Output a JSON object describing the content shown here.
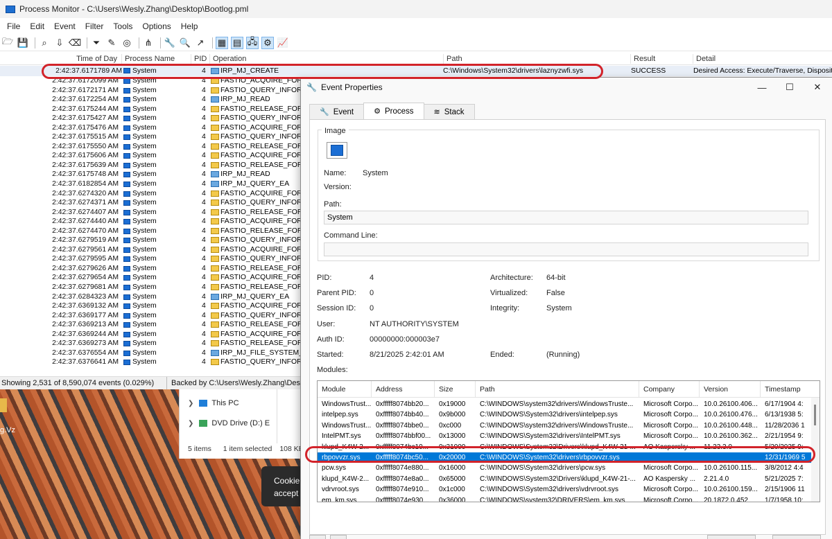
{
  "window": {
    "title": "Process Monitor - C:\\Users\\Wesly.Zhang\\Desktop\\Bootlog.pml"
  },
  "menu": [
    "File",
    "Edit",
    "Event",
    "Filter",
    "Tools",
    "Options",
    "Help"
  ],
  "toolbar_icons": [
    "open-icon",
    "save-icon",
    "capture-icon",
    "autoscroll-icon",
    "clear-icon",
    "filter-icon",
    "highlight-icon",
    "target-icon",
    "tree-icon",
    "find-icon",
    "jump-icon",
    "registry-icon",
    "filesystem-icon",
    "network-icon",
    "process-thread-icon",
    "profiling-icon"
  ],
  "columns": {
    "time": "Time of Day",
    "process": "Process Name",
    "pid": "PID",
    "operation": "Operation",
    "path": "Path",
    "result": "Result",
    "detail": "Detail"
  },
  "first_event": {
    "time": "2:42:37.6171789 AM",
    "process": "System",
    "pid": "4",
    "operation": "IRP_MJ_CREATE",
    "path": "C:\\Windows\\System32\\drivers\\laznyzwfi.sys",
    "result": "SUCCESS",
    "detail": "Desired Access: Execute/Traverse, Disposition"
  },
  "events": [
    {
      "time": "2:42:37.6172099 AM",
      "process": "System",
      "pid": "4",
      "operation": "FASTIO_ACQUIRE_FOR_",
      "kind": "fastio"
    },
    {
      "time": "2:42:37.6172171 AM",
      "process": "System",
      "pid": "4",
      "operation": "FASTIO_QUERY_INFORM",
      "kind": "fastio"
    },
    {
      "time": "2:42:37.6172254 AM",
      "process": "System",
      "pid": "4",
      "operation": "IRP_MJ_READ",
      "kind": "irp"
    },
    {
      "time": "2:42:37.6175244 AM",
      "process": "System",
      "pid": "4",
      "operation": "FASTIO_RELEASE_FOR_",
      "kind": "fastio"
    },
    {
      "time": "2:42:37.6175427 AM",
      "process": "System",
      "pid": "4",
      "operation": "FASTIO_QUERY_INFORM",
      "kind": "fastio"
    },
    {
      "time": "2:42:37.6175476 AM",
      "process": "System",
      "pid": "4",
      "operation": "FASTIO_ACQUIRE_FOR_",
      "kind": "fastio"
    },
    {
      "time": "2:42:37.6175515 AM",
      "process": "System",
      "pid": "4",
      "operation": "FASTIO_QUERY_INFORM",
      "kind": "fastio"
    },
    {
      "time": "2:42:37.6175550 AM",
      "process": "System",
      "pid": "4",
      "operation": "FASTIO_RELEASE_FOR_",
      "kind": "fastio"
    },
    {
      "time": "2:42:37.6175606 AM",
      "process": "System",
      "pid": "4",
      "operation": "FASTIO_ACQUIRE_FOR_",
      "kind": "fastio"
    },
    {
      "time": "2:42:37.6175639 AM",
      "process": "System",
      "pid": "4",
      "operation": "FASTIO_RELEASE_FOR_",
      "kind": "fastio"
    },
    {
      "time": "2:42:37.6175748 AM",
      "process": "System",
      "pid": "4",
      "operation": "IRP_MJ_READ",
      "kind": "irp"
    },
    {
      "time": "2:42:37.6182854 AM",
      "process": "System",
      "pid": "4",
      "operation": "IRP_MJ_QUERY_EA",
      "kind": "irp"
    },
    {
      "time": "2:42:37.6274320 AM",
      "process": "System",
      "pid": "4",
      "operation": "FASTIO_ACQUIRE_FOR_",
      "kind": "fastio"
    },
    {
      "time": "2:42:37.6274371 AM",
      "process": "System",
      "pid": "4",
      "operation": "FASTIO_QUERY_INFORM",
      "kind": "fastio"
    },
    {
      "time": "2:42:37.6274407 AM",
      "process": "System",
      "pid": "4",
      "operation": "FASTIO_RELEASE_FOR_",
      "kind": "fastio"
    },
    {
      "time": "2:42:37.6274440 AM",
      "process": "System",
      "pid": "4",
      "operation": "FASTIO_ACQUIRE_FOR_",
      "kind": "fastio"
    },
    {
      "time": "2:42:37.6274470 AM",
      "process": "System",
      "pid": "4",
      "operation": "FASTIO_RELEASE_FOR_",
      "kind": "fastio"
    },
    {
      "time": "2:42:37.6279519 AM",
      "process": "System",
      "pid": "4",
      "operation": "FASTIO_QUERY_INFORM",
      "kind": "fastio"
    },
    {
      "time": "2:42:37.6279561 AM",
      "process": "System",
      "pid": "4",
      "operation": "FASTIO_ACQUIRE_FOR_",
      "kind": "fastio"
    },
    {
      "time": "2:42:37.6279595 AM",
      "process": "System",
      "pid": "4",
      "operation": "FASTIO_QUERY_INFORM",
      "kind": "fastio"
    },
    {
      "time": "2:42:37.6279626 AM",
      "process": "System",
      "pid": "4",
      "operation": "FASTIO_RELEASE_FOR_",
      "kind": "fastio"
    },
    {
      "time": "2:42:37.6279654 AM",
      "process": "System",
      "pid": "4",
      "operation": "FASTIO_ACQUIRE_FOR_",
      "kind": "fastio"
    },
    {
      "time": "2:42:37.6279681 AM",
      "process": "System",
      "pid": "4",
      "operation": "FASTIO_RELEASE_FOR_",
      "kind": "fastio"
    },
    {
      "time": "2:42:37.6284323 AM",
      "process": "System",
      "pid": "4",
      "operation": "IRP_MJ_QUERY_EA",
      "kind": "irp"
    },
    {
      "time": "2:42:37.6369132 AM",
      "process": "System",
      "pid": "4",
      "operation": "FASTIO_ACQUIRE_FOR_",
      "kind": "fastio"
    },
    {
      "time": "2:42:37.6369177 AM",
      "process": "System",
      "pid": "4",
      "operation": "FASTIO_QUERY_INFORM",
      "kind": "fastio"
    },
    {
      "time": "2:42:37.6369213 AM",
      "process": "System",
      "pid": "4",
      "operation": "FASTIO_RELEASE_FOR_",
      "kind": "fastio"
    },
    {
      "time": "2:42:37.6369244 AM",
      "process": "System",
      "pid": "4",
      "operation": "FASTIO_ACQUIRE_FOR_",
      "kind": "fastio"
    },
    {
      "time": "2:42:37.6369273 AM",
      "process": "System",
      "pid": "4",
      "operation": "FASTIO_RELEASE_FOR_",
      "kind": "fastio"
    },
    {
      "time": "2:42:37.6376554 AM",
      "process": "System",
      "pid": "4",
      "operation": "IRP_MJ_FILE_SYSTEM_C",
      "kind": "irp"
    },
    {
      "time": "2:42:37.6376641 AM",
      "process": "System",
      "pid": "4",
      "operation": "FASTIO_QUERY_INFORM",
      "kind": "fastio"
    }
  ],
  "status": {
    "showing": "Showing 2,531 of 8,590,074 events (0.029%)",
    "backed": "Backed by C:\\Users\\Wesly.Zhang\\Desk"
  },
  "explorer": {
    "this_pc": "This PC",
    "dvd": "DVD Drive (D:) E",
    "items": "5 items",
    "selected": "1 item selected",
    "size": "108 KB"
  },
  "desktop": {
    "label": "g.Vz"
  },
  "cookie": {
    "line1": "Cookie",
    "line2": "accept"
  },
  "dialog": {
    "title": "Event Properties",
    "tabs": {
      "event": "Event",
      "process": "Process",
      "stack": "Stack"
    },
    "image_group": "Image",
    "name_label": "Name:",
    "name_value": "System",
    "version_label": "Version:",
    "path_label": "Path:",
    "path_value": "System",
    "cmd_label": "Command Line:",
    "cmd_value": "",
    "pid_label": "PID:",
    "pid_value": "4",
    "parent_pid_label": "Parent PID:",
    "parent_pid_value": "0",
    "session_label": "Session ID:",
    "session_value": "0",
    "user_label": "User:",
    "user_value": "NT AUTHORITY\\SYSTEM",
    "auth_label": "Auth ID:",
    "auth_value": "00000000:000003e7",
    "started_label": "Started:",
    "started_value": "8/21/2025 2:42:01 AM",
    "arch_label": "Architecture:",
    "arch_value": "64-bit",
    "virt_label": "Virtualized:",
    "virt_value": "False",
    "integrity_label": "Integrity:",
    "integrity_value": "System",
    "ended_label": "Ended:",
    "ended_value": "(Running)",
    "modules_label": "Modules:",
    "module_columns": {
      "module": "Module",
      "address": "Address",
      "size": "Size",
      "path": "Path",
      "company": "Company",
      "version": "Version",
      "timestamp": "Timestamp"
    },
    "modules": [
      {
        "module": "WindowsTrust...",
        "address": "0xfffff8074bb20...",
        "size": "0x19000",
        "path": "C:\\WINDOWS\\system32\\drivers\\WindowsTruste...",
        "company": "Microsoft Corpo...",
        "version": "10.0.26100.406...",
        "timestamp": "6/17/1904 4:"
      },
      {
        "module": "intelpep.sys",
        "address": "0xfffff8074bb40...",
        "size": "0x9b000",
        "path": "C:\\WINDOWS\\System32\\drivers\\intelpep.sys",
        "company": "Microsoft Corpo...",
        "version": "10.0.26100.476...",
        "timestamp": "6/13/1938 5:"
      },
      {
        "module": "WindowsTrust...",
        "address": "0xfffff8074bbe0...",
        "size": "0xc000",
        "path": "C:\\WINDOWS\\system32\\drivers\\WindowsTruste...",
        "company": "Microsoft Corpo...",
        "version": "10.0.26100.448...",
        "timestamp": "11/28/2036 1"
      },
      {
        "module": "IntelPMT.sys",
        "address": "0xfffff8074bbf00...",
        "size": "0x13000",
        "path": "C:\\WINDOWS\\System32\\drivers\\IntelPMT.sys",
        "company": "Microsoft Corpo...",
        "version": "10.0.26100.362...",
        "timestamp": "2/21/1954 9:"
      },
      {
        "module": "klupd_K4W-2...",
        "address": "0xfffff8074bc10...",
        "size": "0x31000",
        "path": "C:\\WINDOWS\\System32\\Drivers\\klupd_K4W-21-...",
        "company": "AO Kaspersky ...",
        "version": "11.23.3.0",
        "timestamp": "5/20/2025 9:"
      },
      {
        "module": "rbpovvzr.sys",
        "address": "0xfffff8074bc50...",
        "size": "0x20000",
        "path": "C:\\WINDOWS\\System32\\drivers\\rbpovvzr.sys",
        "company": "",
        "version": "",
        "timestamp": "12/31/1969 5"
      },
      {
        "module": "pcw.sys",
        "address": "0xfffff8074e880...",
        "size": "0x16000",
        "path": "C:\\WINDOWS\\System32\\drivers\\pcw.sys",
        "company": "Microsoft Corpo...",
        "version": "10.0.26100.115...",
        "timestamp": "3/8/2012 4:4"
      },
      {
        "module": "klupd_K4W-2...",
        "address": "0xfffff8074e8a0...",
        "size": "0x65000",
        "path": "C:\\WINDOWS\\System32\\Drivers\\klupd_K4W-21-...",
        "company": "AO Kaspersky ...",
        "version": "2.21.4.0",
        "timestamp": "5/21/2025 7:"
      },
      {
        "module": "vdrvroot.sys",
        "address": "0xfffff8074e910...",
        "size": "0x1c000",
        "path": "C:\\WINDOWS\\System32\\drivers\\vdrvroot.sys",
        "company": "Microsoft Corpo...",
        "version": "10.0.26100.159...",
        "timestamp": "2/15/1906 11"
      },
      {
        "module": "em_km.sys",
        "address": "0xfffff8074e930...",
        "size": "0x36000",
        "path": "C:\\WINDOWS\\system32\\DRIVERS\\em_km.sys",
        "company": "Microsoft Corpo...",
        "version": "20.1872.0.452",
        "timestamp": "1/7/1958 10:"
      }
    ],
    "selected_module_index": 5
  },
  "colors": {
    "selection": "#0078d7",
    "highlight": "#d2232a",
    "accent": "#1b6ed4"
  }
}
